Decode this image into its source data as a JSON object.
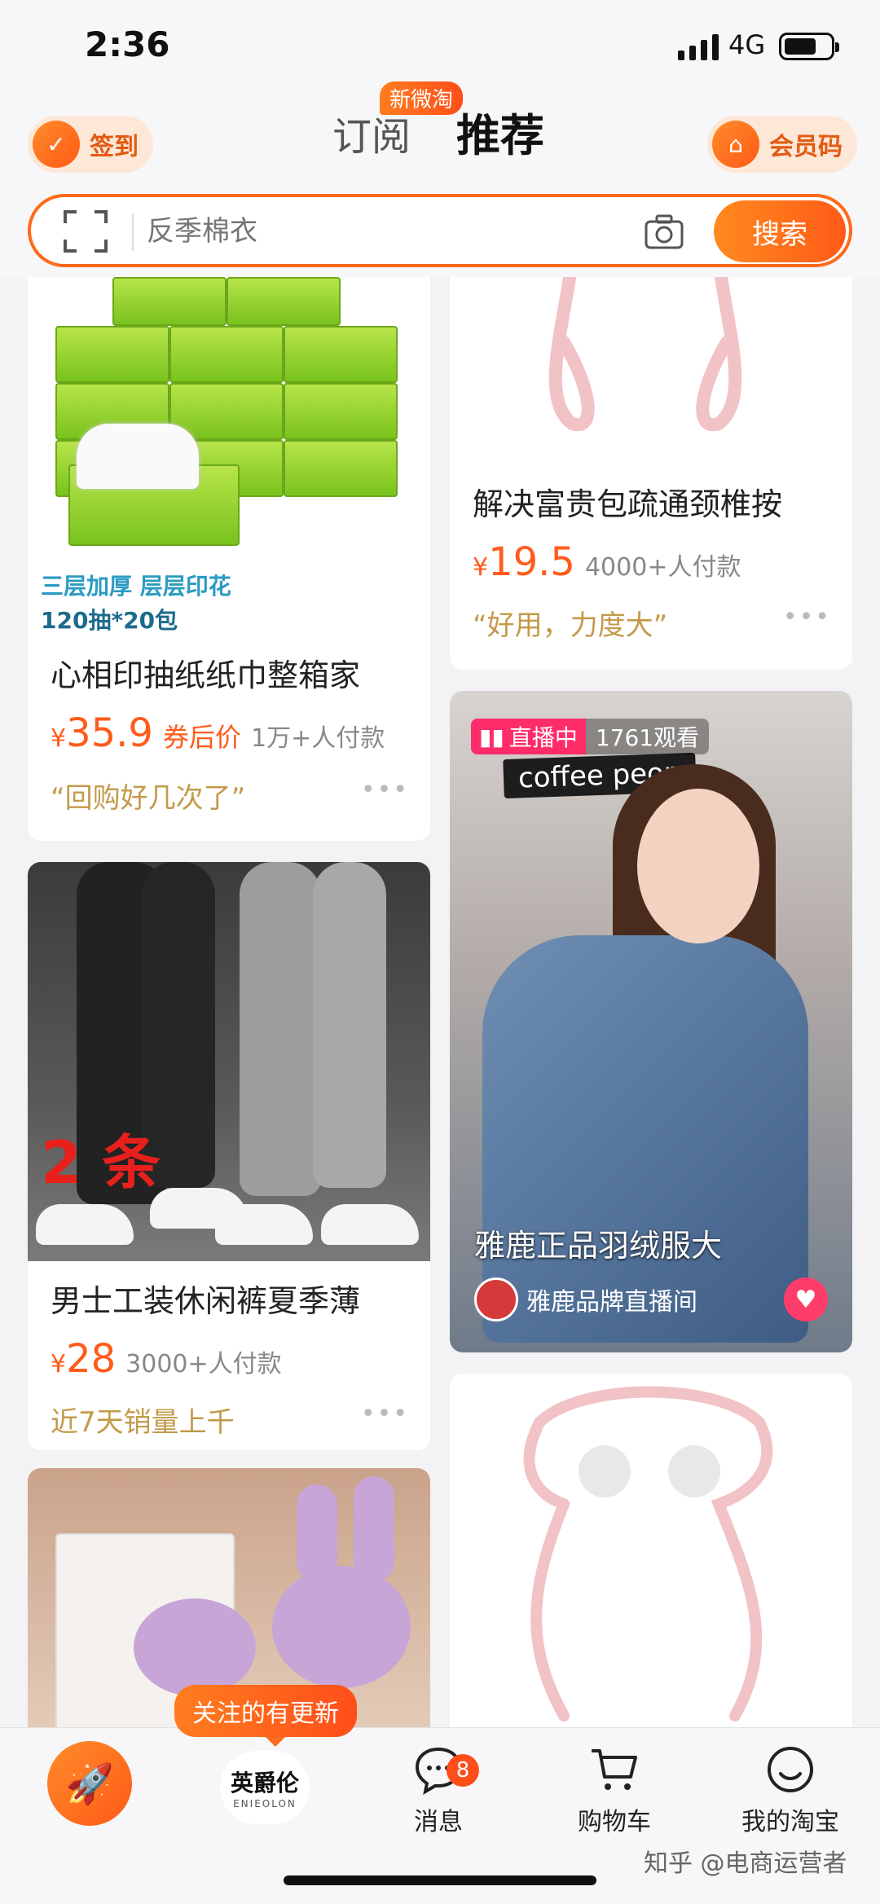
{
  "status": {
    "time": "2:36",
    "network": "4G"
  },
  "header": {
    "checkin": "签到",
    "badge_new": "新微淘",
    "tab_subscribe": "订阅",
    "tab_recommend": "推荐",
    "member_code": "会员码"
  },
  "search": {
    "placeholder": "反季棉衣",
    "button": "搜索"
  },
  "cards": {
    "tissue": {
      "promo1": "三层加厚 层层印花",
      "promo2": "120抽*20包",
      "title": "心相印抽纸纸巾整箱家",
      "yen": "¥",
      "price": "35.9",
      "coupon": "券后价",
      "paid": "1万+人付款",
      "note": "“回购好几次了”",
      "more": "•••"
    },
    "massager1": {
      "title": "解决富贵包疏通颈椎按",
      "yen": "¥",
      "price": "19.5",
      "paid": "4000+人付款",
      "note": "“好用，力度大”",
      "more": "•••"
    },
    "pants": {
      "overlay": "2 条",
      "title": "男士工装休闲裤夏季薄",
      "yen": "¥",
      "price": "28",
      "paid": "3000+人付款",
      "note": "近7天销量上千",
      "more": "•••"
    },
    "live": {
      "status": "直播中",
      "viewers": "1761观看",
      "sign": "coffee peop",
      "title": "雅鹿正品羽绒服大",
      "room": "雅鹿品牌直播间"
    }
  },
  "tabbar": {
    "follow_tip": "关注的有更新",
    "brand": "英爵伦",
    "brand_sub": "ENIEOLON",
    "messages": "消息",
    "messages_count": "8",
    "cart": "购物车",
    "mine": "我的淘宝"
  },
  "watermark": "知乎 @电商运营者",
  "colors": {
    "accent": "#ff5b17",
    "price": "#ff5b1b",
    "live": "#ff2c6a"
  }
}
